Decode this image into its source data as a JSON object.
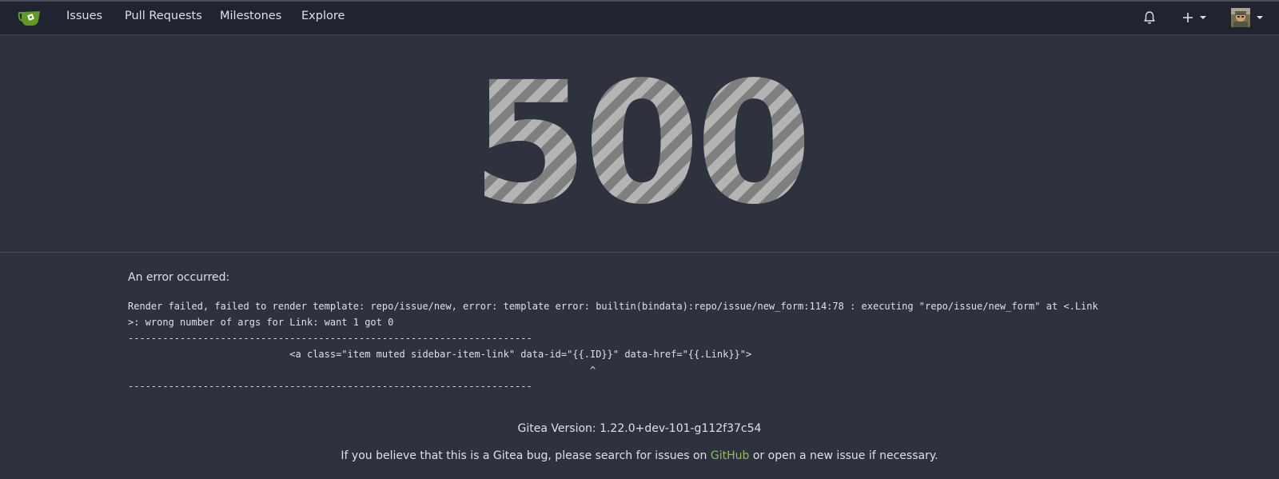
{
  "nav": {
    "items": [
      {
        "label": "Issues"
      },
      {
        "label": "Pull Requests"
      },
      {
        "label": "Milestones"
      },
      {
        "label": "Explore"
      }
    ],
    "icons": [
      "gitea-logo-icon",
      "bell-icon",
      "plus-icon",
      "avatar"
    ]
  },
  "error": {
    "code": "500",
    "heading": "An error occurred:",
    "details": "Render failed, failed to render template: repo/issue/new, error: template error: builtin(bindata):repo/issue/new_form:114:78 : executing \"repo/issue/new_form\" at <.Link\n>: wrong number of args for Link: want 1 got 0\n----------------------------------------------------------------------\n                            <a class=\"item muted sidebar-item-link\" data-id=\"{{.ID}}\" data-href=\"{{.Link}}\">\n                                                                                ^\n----------------------------------------------------------------------"
  },
  "footer": {
    "version": "Gitea Version: 1.22.0+dev-101-g112f37c54",
    "bug_prefix": "If you believe that this is a Gitea bug, please search for issues on ",
    "github_link": "GitHub",
    "bug_suffix": " or open a new issue if necessary."
  },
  "colors": {
    "background": "#2e323e",
    "navbar": "#202430",
    "text": "#dbe0ea",
    "link": "#8fbc5a",
    "logo": "#609926"
  }
}
